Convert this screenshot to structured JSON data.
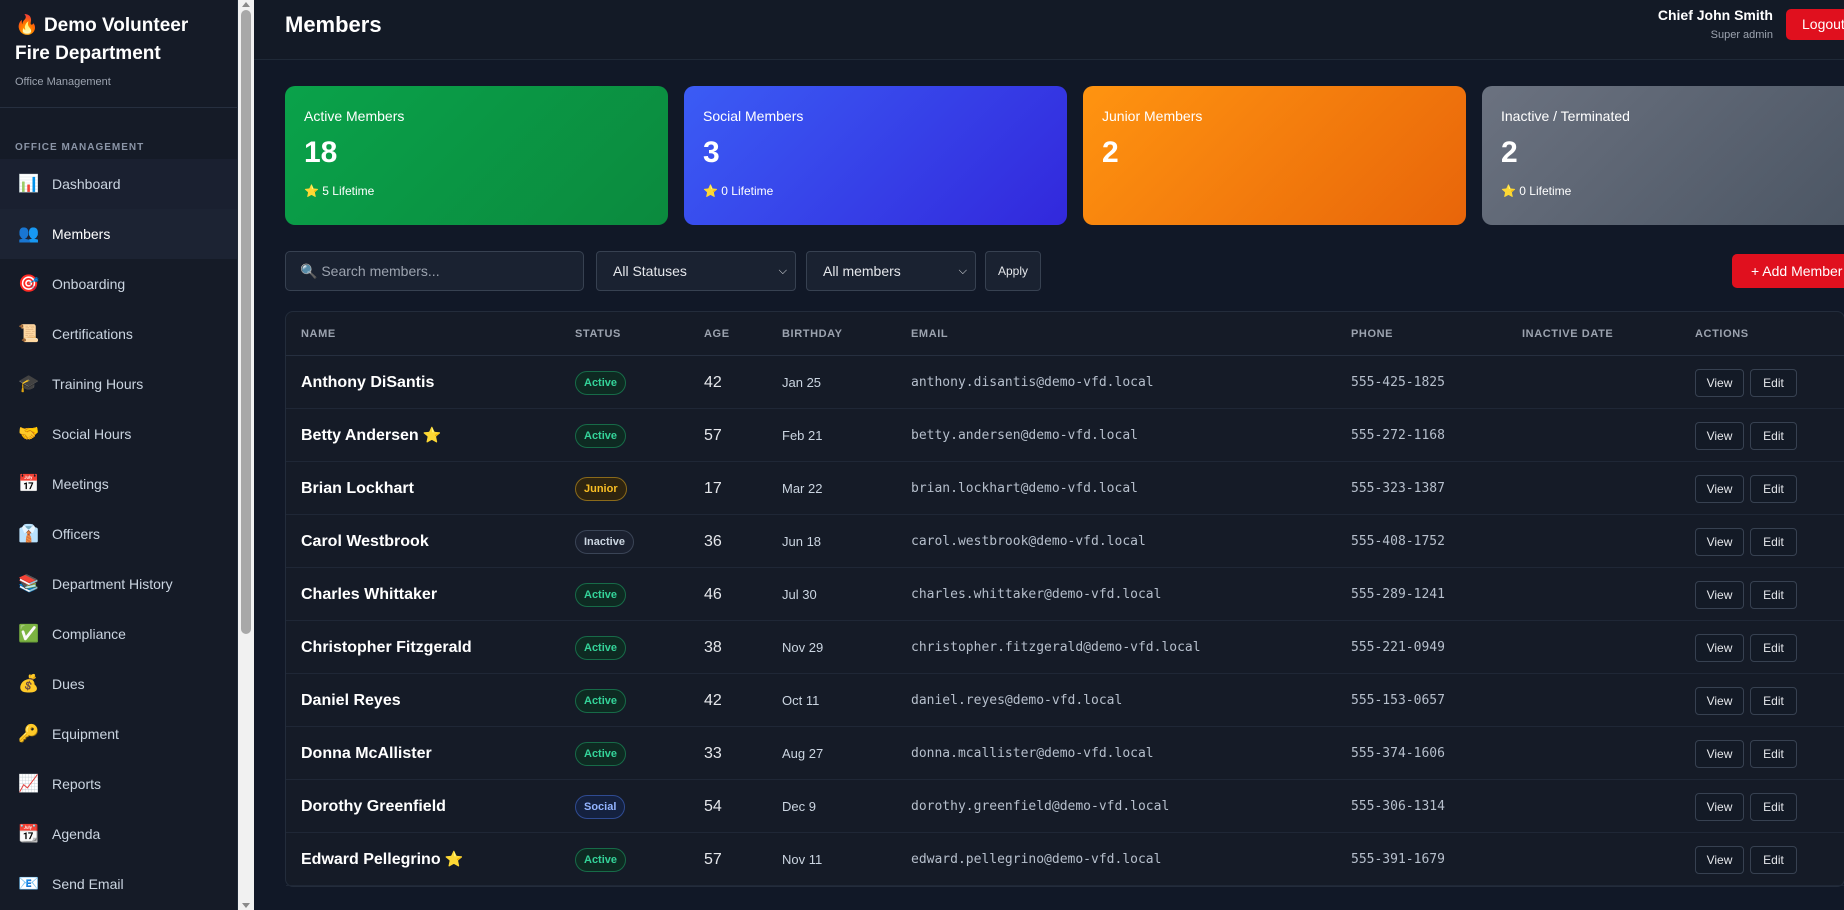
{
  "sidebar": {
    "brand_icon": "🔥",
    "brand_title": "Demo Volunteer Fire Department",
    "brand_sub": "Office Management",
    "section_label": "OFFICE MANAGEMENT",
    "items": [
      {
        "icon": "📊",
        "label": "Dashboard",
        "name": "dashboard"
      },
      {
        "icon": "👥",
        "label": "Members",
        "name": "members"
      },
      {
        "icon": "🎯",
        "label": "Onboarding",
        "name": "onboarding"
      },
      {
        "icon": "📜",
        "label": "Certifications",
        "name": "certifications"
      },
      {
        "icon": "🎓",
        "label": "Training Hours",
        "name": "training-hours"
      },
      {
        "icon": "🤝",
        "label": "Social Hours",
        "name": "social-hours"
      },
      {
        "icon": "📅",
        "label": "Meetings",
        "name": "meetings"
      },
      {
        "icon": "👔",
        "label": "Officers",
        "name": "officers"
      },
      {
        "icon": "📚",
        "label": "Department History",
        "name": "department-history"
      },
      {
        "icon": "✅",
        "label": "Compliance",
        "name": "compliance"
      },
      {
        "icon": "💰",
        "label": "Dues",
        "name": "dues"
      },
      {
        "icon": "🔑",
        "label": "Equipment",
        "name": "equipment"
      },
      {
        "icon": "📈",
        "label": "Reports",
        "name": "reports"
      },
      {
        "icon": "📆",
        "label": "Agenda",
        "name": "agenda"
      },
      {
        "icon": "📧",
        "label": "Send Email",
        "name": "send-email"
      }
    ]
  },
  "header": {
    "title": "Members",
    "user_name": "Chief John Smith",
    "user_role": "Super admin",
    "logout_label": "Logout"
  },
  "stats": [
    {
      "label": "Active Members",
      "value": "18",
      "lifetime": "5 Lifetime",
      "gradient": [
        "#0aa24a",
        "#0b8a3e"
      ]
    },
    {
      "label": "Social Members",
      "value": "3",
      "lifetime": "0 Lifetime",
      "gradient": [
        "#3b5cf5",
        "#3228dc"
      ]
    },
    {
      "label": "Junior Members",
      "value": "2",
      "lifetime": "",
      "gradient": [
        "#ff9410",
        "#e8650a"
      ]
    },
    {
      "label": "Inactive / Terminated",
      "value": "2",
      "lifetime": "0 Lifetime",
      "gradient": [
        "#6b7280",
        "#4b5563"
      ]
    }
  ],
  "filters": {
    "search_icon": "🔍",
    "search_placeholder": "Search members...",
    "status_select": "All Statuses",
    "member_select": "All members",
    "apply_label": "Apply",
    "add_label": "+ Add Member"
  },
  "table": {
    "columns": [
      "NAME",
      "STATUS",
      "AGE",
      "BIRTHDAY",
      "EMAIL",
      "PHONE",
      "INACTIVE DATE",
      "ACTIONS"
    ],
    "view_label": "View",
    "edit_label": "Edit",
    "rows": [
      {
        "name": "Anthony DiSantis",
        "status": "Active",
        "age": "42",
        "birthday": "Jan 25",
        "email": "anthony.disantis@demo-vfd.local",
        "phone": "555-425-1825",
        "inactive_date": "",
        "star": false
      },
      {
        "name": "Betty Andersen",
        "status": "Active",
        "age": "57",
        "birthday": "Feb 21",
        "email": "betty.andersen@demo-vfd.local",
        "phone": "555-272-1168",
        "inactive_date": "",
        "star": true
      },
      {
        "name": "Brian Lockhart",
        "status": "Junior",
        "age": "17",
        "birthday": "Mar 22",
        "email": "brian.lockhart@demo-vfd.local",
        "phone": "555-323-1387",
        "inactive_date": "",
        "star": false
      },
      {
        "name": "Carol Westbrook",
        "status": "Inactive",
        "age": "36",
        "birthday": "Jun 18",
        "email": "carol.westbrook@demo-vfd.local",
        "phone": "555-408-1752",
        "inactive_date": "",
        "star": false
      },
      {
        "name": "Charles Whittaker",
        "status": "Active",
        "age": "46",
        "birthday": "Jul 30",
        "email": "charles.whittaker@demo-vfd.local",
        "phone": "555-289-1241",
        "inactive_date": "",
        "star": false
      },
      {
        "name": "Christopher Fitzgerald",
        "status": "Active",
        "age": "38",
        "birthday": "Nov 29",
        "email": "christopher.fitzgerald@demo-vfd.local",
        "phone": "555-221-0949",
        "inactive_date": "",
        "star": false
      },
      {
        "name": "Daniel Reyes",
        "status": "Active",
        "age": "42",
        "birthday": "Oct 11",
        "email": "daniel.reyes@demo-vfd.local",
        "phone": "555-153-0657",
        "inactive_date": "",
        "star": false
      },
      {
        "name": "Donna McAllister",
        "status": "Active",
        "age": "33",
        "birthday": "Aug 27",
        "email": "donna.mcallister@demo-vfd.local",
        "phone": "555-374-1606",
        "inactive_date": "",
        "star": false
      },
      {
        "name": "Dorothy Greenfield",
        "status": "Social",
        "age": "54",
        "birthday": "Dec 9",
        "email": "dorothy.greenfield@demo-vfd.local",
        "phone": "555-306-1314",
        "inactive_date": "",
        "star": false
      },
      {
        "name": "Edward Pellegrino",
        "status": "Active",
        "age": "57",
        "birthday": "Nov 11",
        "email": "edward.pellegrino@demo-vfd.local",
        "phone": "555-391-1679",
        "inactive_date": "",
        "star": true
      }
    ]
  }
}
